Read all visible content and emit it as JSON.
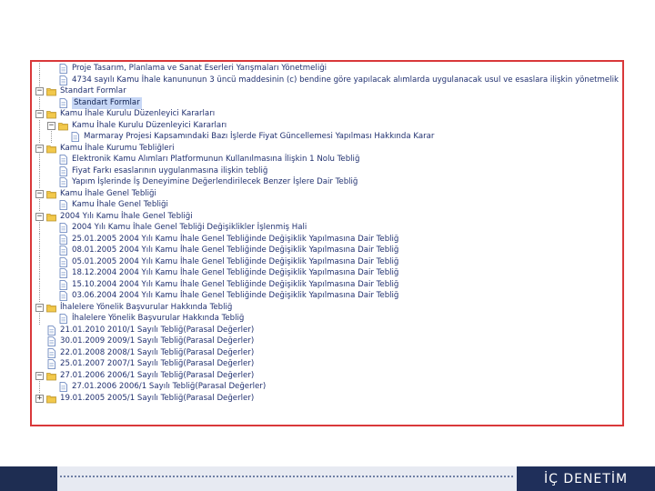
{
  "tree": {
    "rows": [
      {
        "depth": 1,
        "icon": "doc",
        "toggle": "",
        "label": "Proje Tasarım, Planlama ve Sanat Eserleri Yarışmaları Yönetmeliği"
      },
      {
        "depth": 1,
        "icon": "doc",
        "toggle": "",
        "label": "4734 sayılı Kamu İhale kanununun 3 üncü maddesinin (c) bendine göre yapılacak alımlarda uygulanacak usul ve esaslara ilişkin yönetmelik"
      },
      {
        "depth": 0,
        "icon": "folder",
        "toggle": "−",
        "label": "Standart Formlar"
      },
      {
        "depth": 1,
        "icon": "doc",
        "toggle": "",
        "label": "Standart Formlar",
        "selected": true
      },
      {
        "depth": 0,
        "icon": "folder",
        "toggle": "−",
        "label": "Kamu İhale Kurulu Düzenleyici Kararları"
      },
      {
        "depth": 1,
        "icon": "folder",
        "toggle": "−",
        "label": "Kamu İhale Kurulu Düzenleyici Kararları"
      },
      {
        "depth": 2,
        "icon": "doc",
        "toggle": "",
        "label": "Marmaray Projesi Kapsamındaki Bazı İşlerde Fiyat Güncellemesi Yapılması Hakkında Karar"
      },
      {
        "depth": 0,
        "icon": "folder",
        "toggle": "−",
        "label": "Kamu İhale Kurumu Tebliğleri"
      },
      {
        "depth": 1,
        "icon": "doc",
        "toggle": "",
        "label": "Elektronik Kamu Alımları Platformunun Kullanılmasına İlişkin 1 Nolu Tebliğ"
      },
      {
        "depth": 1,
        "icon": "doc",
        "toggle": "",
        "label": "Fiyat Farkı esaslarının uygulanmasına ilişkin tebliğ"
      },
      {
        "depth": 1,
        "icon": "doc",
        "toggle": "",
        "label": "Yapım İşlerinde İş Deneyimine Değerlendirilecek Benzer İşlere Dair Tebliğ"
      },
      {
        "depth": 0,
        "icon": "folder",
        "toggle": "−",
        "label": "Kamu İhale Genel Tebliği"
      },
      {
        "depth": 1,
        "icon": "doc",
        "toggle": "",
        "label": "Kamu İhale Genel Tebliği"
      },
      {
        "depth": 0,
        "icon": "folder",
        "toggle": "−",
        "label": "2004 Yılı Kamu İhale Genel Tebliği"
      },
      {
        "depth": 1,
        "icon": "doc",
        "toggle": "",
        "label": "2004 Yılı Kamu İhale Genel Tebliği Değişiklikler İşlenmiş Hali"
      },
      {
        "depth": 1,
        "icon": "doc",
        "toggle": "",
        "label": "25.01.2005 2004 Yılı Kamu İhale Genel Tebliğinde Değişiklik Yapılmasına Dair Tebliğ"
      },
      {
        "depth": 1,
        "icon": "doc",
        "toggle": "",
        "label": "08.01.2005 2004 Yılı Kamu İhale Genel Tebliğinde Değişiklik Yapılmasına Dair Tebliğ"
      },
      {
        "depth": 1,
        "icon": "doc",
        "toggle": "",
        "label": "05.01.2005 2004 Yılı Kamu İhale Genel Tebliğinde Değişiklik Yapılmasına Dair Tebliğ"
      },
      {
        "depth": 1,
        "icon": "doc",
        "toggle": "",
        "label": "18.12.2004 2004 Yılı Kamu İhale Genel Tebliğinde Değişiklik Yapılmasına Dair Tebliğ"
      },
      {
        "depth": 1,
        "icon": "doc",
        "toggle": "",
        "label": "15.10.2004 2004 Yılı Kamu İhale Genel Tebliğinde Değişiklik Yapılmasına Dair Tebliğ"
      },
      {
        "depth": 1,
        "icon": "doc",
        "toggle": "",
        "label": "03.06.2004 2004 Yılı Kamu İhale Genel Tebliğinde Değişiklik Yapılmasına Dair Tebliğ"
      },
      {
        "depth": 0,
        "icon": "folder",
        "toggle": "−",
        "label": "İhalelere Yönelik Başvurular Hakkında Tebliğ"
      },
      {
        "depth": 1,
        "icon": "doc",
        "toggle": "",
        "label": "İhalelere Yönelik Başvurular Hakkında Tebliğ"
      },
      {
        "depth": 0,
        "icon": "doc",
        "toggle": "",
        "label": "21.01.2010 2010/1 Sayılı Tebliğ(Parasal Değerler)"
      },
      {
        "depth": 0,
        "icon": "doc",
        "toggle": "",
        "label": "30.01.2009 2009/1 Sayılı Tebliğ(Parasal Değerler)"
      },
      {
        "depth": 0,
        "icon": "doc",
        "toggle": "",
        "label": "22.01.2008 2008/1 Sayılı Tebliğ(Parasal Değerler)"
      },
      {
        "depth": 0,
        "icon": "doc",
        "toggle": "",
        "label": "25.01.2007 2007/1 Sayılı Tebliğ(Parasal Değerler)"
      },
      {
        "depth": 0,
        "icon": "folder",
        "toggle": "−",
        "label": "27.01.2006 2006/1 Sayılı Tebliğ(Parasal Değerler)"
      },
      {
        "depth": 1,
        "icon": "doc",
        "toggle": "",
        "label": "27.01.2006 2006/1 Sayılı Tebliğ(Parasal Değerler)"
      },
      {
        "depth": 0,
        "icon": "folder",
        "toggle": "+",
        "label": "19.01.2005 2005/1 Sayılı Tebliğ(Parasal Değerler)"
      }
    ]
  },
  "footer": {
    "title": "İÇ DENETİM"
  },
  "colors": {
    "frame_border": "#d9383a",
    "footer_dark": "#1f2f5a",
    "folder": "#f2c94c",
    "label_text": "#20306f"
  }
}
